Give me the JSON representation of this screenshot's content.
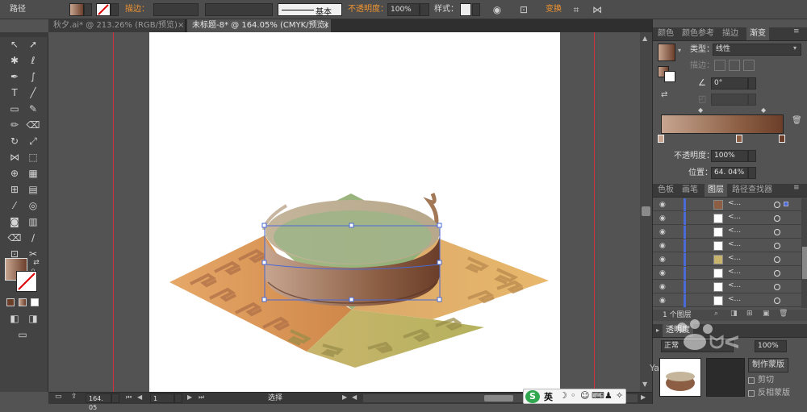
{
  "control_bar": {
    "object_type": "路径",
    "stroke_label": "描边：",
    "stroke_style": "基本",
    "opacity_label": "不透明度：",
    "opacity_value": "100%",
    "style_label": "样式：",
    "transform_label": "变换"
  },
  "document_tabs": [
    {
      "label": "秋夕.ai* @ 213.26% (RGB/预览)"
    },
    {
      "label": "未标题-8* @ 164.05% (CMYK/预览)"
    }
  ],
  "gradient_panel": {
    "tabs": [
      "颜色",
      "颜色参考",
      "描边",
      "渐变"
    ],
    "type_label": "类型：",
    "type_value": "线性",
    "stroke_label": "描边：",
    "angle_value": "0°",
    "opacity_label": "不透明度：",
    "opacity_value": "100%",
    "location_label": "位置：",
    "location_value": "64. 04%",
    "colors": {
      "start": "#c7a590",
      "end": "#6b3e2a"
    }
  },
  "layers_panel": {
    "tabs": [
      "色板",
      "画笔",
      "图层",
      "路径查找器"
    ],
    "rows": [
      "<...",
      "<...",
      "<...",
      "<...",
      "<...",
      "<...",
      "<...",
      "<..."
    ],
    "footer": "1 个图层"
  },
  "transparency_panel": {
    "tab": "透明度",
    "mode": "正常",
    "opacity_value": "100%",
    "make_mask_button": "制作蒙版",
    "clip_label": "剪切",
    "invert_mask_label": "反相蒙版"
  },
  "status_bar": {
    "zoom_value": "164. 05",
    "artboard_value": "1",
    "tool_label": "选择"
  },
  "ime": {
    "lang": "英"
  },
  "watermark": "Yabl"
}
